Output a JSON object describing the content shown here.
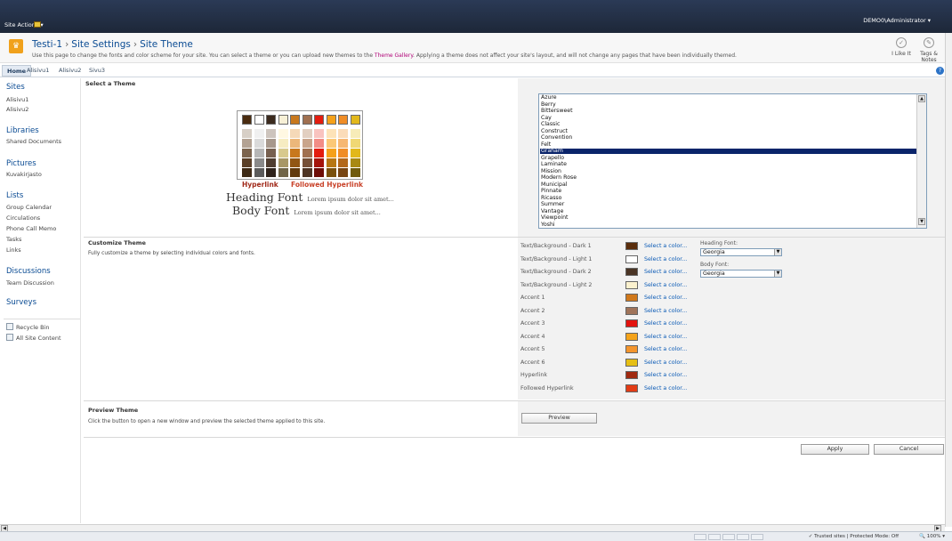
{
  "ribbon": {
    "site_actions": "Site Actions ▾",
    "user_menu": "DEMO0\\Administrator ▾"
  },
  "title": {
    "site": "Testi-1",
    "section": "Site Settings",
    "page": "Site Theme",
    "description_pre": "Use this page to change the fonts and color scheme for your site. You can select a theme or you can upload new themes to the ",
    "gallery_link": "Theme Gallery",
    "description_post": ". Applying a theme does not affect your site's layout, and will not change any pages that have been individually themed.",
    "i_like_it": "I Like It",
    "tags_notes": "Tags & Notes"
  },
  "topnav": {
    "tabs": [
      "Home",
      "Alisivu1",
      "Alisivu2",
      "Sivu3"
    ]
  },
  "quicklaunch": {
    "sites_heading": "Sites",
    "sites_items": [
      "Alisivu1",
      "Alisivu2"
    ],
    "libraries_heading": "Libraries",
    "libraries_items": [
      "Shared Documents"
    ],
    "pictures_heading": "Pictures",
    "pictures_items": [
      "Kuvakirjasto"
    ],
    "lists_heading": "Lists",
    "lists_items": [
      "Group Calendar",
      "Circulations",
      "Phone Call Memo",
      "Tasks",
      "Links"
    ],
    "discussions_heading": "Discussions",
    "discussions_items": [
      "Team Discussion"
    ],
    "surveys_heading": "Surveys",
    "recycle_bin": "Recycle Bin",
    "all_site_content": "All Site Content"
  },
  "select_theme": {
    "title": "Select a Theme",
    "hyperlink": "Hyperlink",
    "followed_hyperlink": "Followed Hyperlink",
    "heading_font": "Heading Font",
    "body_font": "Body Font",
    "lorem": "Lorem ipsum dolor sit amet...",
    "themes": [
      "Azure",
      "Berry",
      "Bittersweet",
      "Cay",
      "Classic",
      "Construct",
      "Convention",
      "Felt",
      "Graham",
      "Grapello",
      "Laminate",
      "Mission",
      "Modern Rose",
      "Municipal",
      "Pinnate",
      "Ricasso",
      "Summer",
      "Vantage",
      "Viewpoint",
      "Yoshi"
    ],
    "selected_theme": "Graham",
    "top_swatches": [
      "#4a2c10",
      "#ffffff",
      "#3b2a1e",
      "#f7f0d6",
      "#c8781d",
      "#a07050",
      "#e31c0f",
      "#f5a11a",
      "#f08d26",
      "#e2b81b"
    ],
    "shade_colors": [
      [
        "#d7cfc6",
        "#f0f0f0",
        "#cdc4bd",
        "#fff8e2",
        "#f5d9b8",
        "#e2cfc1",
        "#f9c3bf",
        "#fde3b8",
        "#fbdcb9",
        "#f7ecb8"
      ],
      [
        "#b3a293",
        "#dadada",
        "#a7988c",
        "#f6ecc2",
        "#ecb77a",
        "#c9a58c",
        "#f28d86",
        "#fbc877",
        "#f6b772",
        "#f0d874"
      ],
      [
        "#7c644e",
        "#b6b6b6",
        "#776050",
        "#d8c98d",
        "#c8781d",
        "#a07050",
        "#e31c0f",
        "#f5a11a",
        "#f08d26",
        "#e2b81b"
      ],
      [
        "#5a3f27",
        "#8a8a8a",
        "#4f3d30",
        "#a89766",
        "#915614",
        "#765038",
        "#a5140b",
        "#b77713",
        "#b3681b",
        "#a88913"
      ],
      [
        "#3e2a15",
        "#5c5c5c",
        "#2f231b",
        "#716548",
        "#613a0d",
        "#4f3525",
        "#6e0d07",
        "#7a500c",
        "#784512",
        "#715b0d"
      ]
    ]
  },
  "customize_theme": {
    "title": "Customize Theme",
    "description": "Fully customize a theme by selecting individual colors and fonts.",
    "select_link": "Select a color...",
    "rows": [
      {
        "label": "Text/Background - Dark 1",
        "color": "#5a2d0c"
      },
      {
        "label": "Text/Background - Light 1",
        "color": "#ffffff"
      },
      {
        "label": "Text/Background - Dark 2",
        "color": "#4a3424"
      },
      {
        "label": "Text/Background - Light 2",
        "color": "#fbf1ce"
      },
      {
        "label": "Accent 1",
        "color": "#d0781b"
      },
      {
        "label": "Accent 2",
        "color": "#a0745a"
      },
      {
        "label": "Accent 3",
        "color": "#e3130e"
      },
      {
        "label": "Accent 4",
        "color": "#f5a31a"
      },
      {
        "label": "Accent 5",
        "color": "#f4952d"
      },
      {
        "label": "Accent 6",
        "color": "#e6bf14"
      },
      {
        "label": "Hyperlink",
        "color": "#a12a10"
      },
      {
        "label": "Followed Hyperlink",
        "color": "#e33c16"
      }
    ],
    "heading_font_label": "Heading Font:",
    "heading_font_value": "Georgia",
    "body_font_label": "Body Font:",
    "body_font_value": "Georgia"
  },
  "preview_theme": {
    "title": "Preview Theme",
    "description": "Click the button to open a new window and preview the selected theme applied to this site.",
    "button": "Preview"
  },
  "actions": {
    "apply": "Apply",
    "cancel": "Cancel"
  },
  "statusbar": {
    "zone": "Trusted sites | Protected Mode: Off",
    "zoom": "100%"
  }
}
